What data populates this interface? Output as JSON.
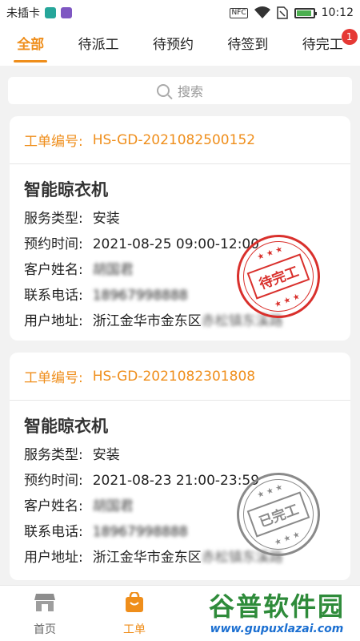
{
  "status_bar": {
    "carrier": "未插卡",
    "nfc": "NFC",
    "time": "10:12",
    "battery_level": 0.9
  },
  "tabs": [
    {
      "label": "全部",
      "active": true
    },
    {
      "label": "待派工"
    },
    {
      "label": "待预约"
    },
    {
      "label": "待签到"
    },
    {
      "label": "待完工",
      "badge": "1"
    }
  ],
  "search": {
    "placeholder": "搜索"
  },
  "orders": [
    {
      "order_label": "工单编号:",
      "order_no": "HS-GD-2021082500152",
      "product": "智能晾衣机",
      "service_type_label": "服务类型:",
      "service_type": "安装",
      "appointment_label": "预约时间:",
      "appointment": "2021-08-25 09:00-12:00",
      "customer_label": "客户姓名:",
      "customer": "胡国君",
      "phone_label": "联系电话:",
      "phone": "18967998888",
      "address_label": "用户地址:",
      "address": "浙江金华市金东区",
      "address_detail": "赤松镇东溪路",
      "stamp": "待完工",
      "stamp_color": "#d9302c"
    },
    {
      "order_label": "工单编号:",
      "order_no": "HS-GD-2021082301808",
      "product": "智能晾衣机",
      "service_type_label": "服务类型:",
      "service_type": "安装",
      "appointment_label": "预约时间:",
      "appointment": "2021-08-23 21:00-23:59",
      "customer_label": "客户姓名:",
      "customer": "胡国君",
      "phone_label": "联系电话:",
      "phone": "18967998888",
      "address_label": "用户地址:",
      "address": "浙江金华市金东区",
      "address_detail": "赤松镇东溪路",
      "stamp": "已完工",
      "stamp_color": "#8a8a8a"
    }
  ],
  "bottom_nav": [
    {
      "label": "首页",
      "icon": "store-icon"
    },
    {
      "label": "工单",
      "icon": "bag-icon",
      "active": true
    }
  ],
  "watermark": {
    "logo": "谷普软件园",
    "url": "www.gupuxlazai.com"
  },
  "colors": {
    "accent": "#ef8e1b",
    "badge": "#e53935",
    "stamp_pending": "#d9302c",
    "stamp_done": "#8a8a8a"
  }
}
